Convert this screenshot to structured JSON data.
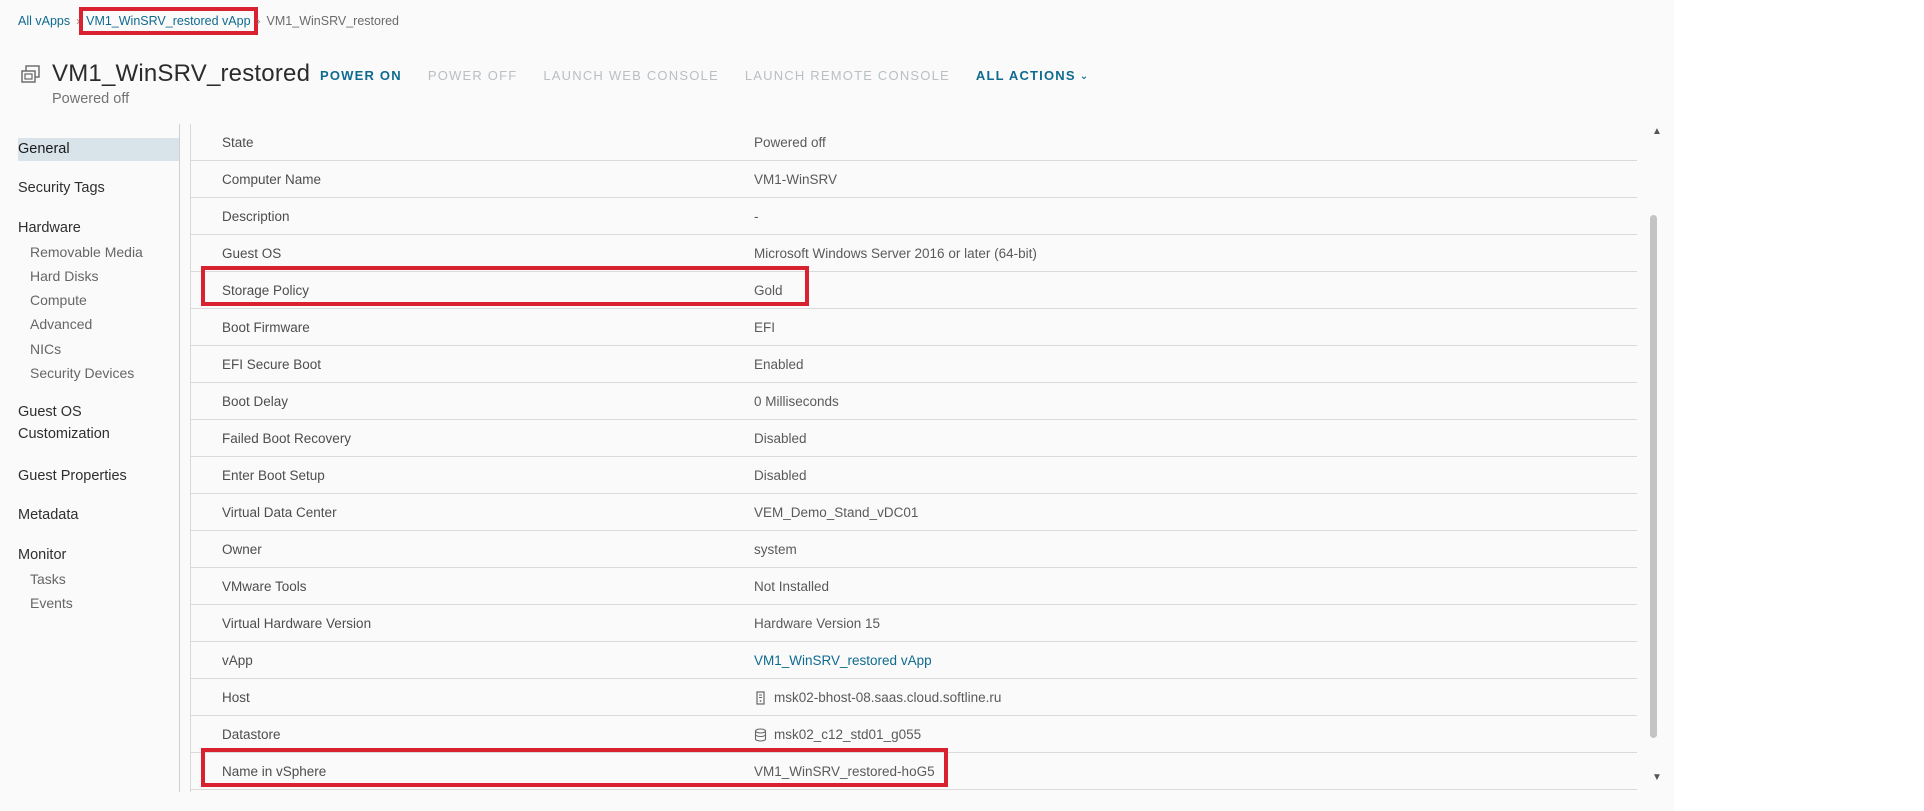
{
  "breadcrumb": {
    "root": "All vApps",
    "parent": "VM1_WinSRV_restored vApp",
    "current": "VM1_WinSRV_restored"
  },
  "header": {
    "title": "VM1_WinSRV_restored",
    "status": "Powered off",
    "actions": {
      "power_on": "POWER ON",
      "power_off": "POWER OFF",
      "launch_web_console": "LAUNCH WEB CONSOLE",
      "launch_remote_console": "LAUNCH REMOTE CONSOLE",
      "all_actions": "ALL ACTIONS"
    }
  },
  "nav": {
    "general": "General",
    "security_tags": "Security Tags",
    "hardware": "Hardware",
    "removable_media": "Removable Media",
    "hard_disks": "Hard Disks",
    "compute": "Compute",
    "advanced": "Advanced",
    "nics": "NICs",
    "security_devices": "Security Devices",
    "guest_os_line1": "Guest OS",
    "guest_os_line2": "Customization",
    "guest_properties": "Guest Properties",
    "metadata": "Metadata",
    "monitor": "Monitor",
    "tasks": "Tasks",
    "events": "Events"
  },
  "properties": [
    {
      "label": "State",
      "value": "Powered off"
    },
    {
      "label": "Computer Name",
      "value": "VM1-WinSRV"
    },
    {
      "label": "Description",
      "value": "-"
    },
    {
      "label": "Guest OS",
      "value": "Microsoft Windows Server 2016 or later (64-bit)"
    },
    {
      "label": "Storage Policy",
      "value": "Gold"
    },
    {
      "label": "Boot Firmware",
      "value": "EFI"
    },
    {
      "label": "EFI Secure Boot",
      "value": "Enabled"
    },
    {
      "label": "Boot Delay",
      "value": "0 Milliseconds"
    },
    {
      "label": "Failed Boot Recovery",
      "value": "Disabled"
    },
    {
      "label": "Enter Boot Setup",
      "value": "Disabled"
    },
    {
      "label": "Virtual Data Center",
      "value": "VEM_Demo_Stand_vDC01"
    },
    {
      "label": "Owner",
      "value": "system"
    },
    {
      "label": "VMware Tools",
      "value": "Not Installed"
    },
    {
      "label": "Virtual Hardware Version",
      "value": "Hardware Version 15"
    },
    {
      "label": "vApp",
      "value": "VM1_WinSRV_restored vApp"
    },
    {
      "label": "Host",
      "value": "msk02-bhost-08.saas.cloud.softline.ru"
    },
    {
      "label": "Datastore",
      "value": "msk02_c12_std01_g055"
    },
    {
      "label": "Name in vSphere",
      "value": "VM1_WinSRV_restored-hoG5"
    }
  ],
  "icons": {
    "vm": "vm-icon",
    "host": "host-icon",
    "datastore": "datastore-icon"
  },
  "colors": {
    "link": "#0e6b8f",
    "highlight": "#d8222f",
    "active_nav": "#d8e3ea"
  }
}
